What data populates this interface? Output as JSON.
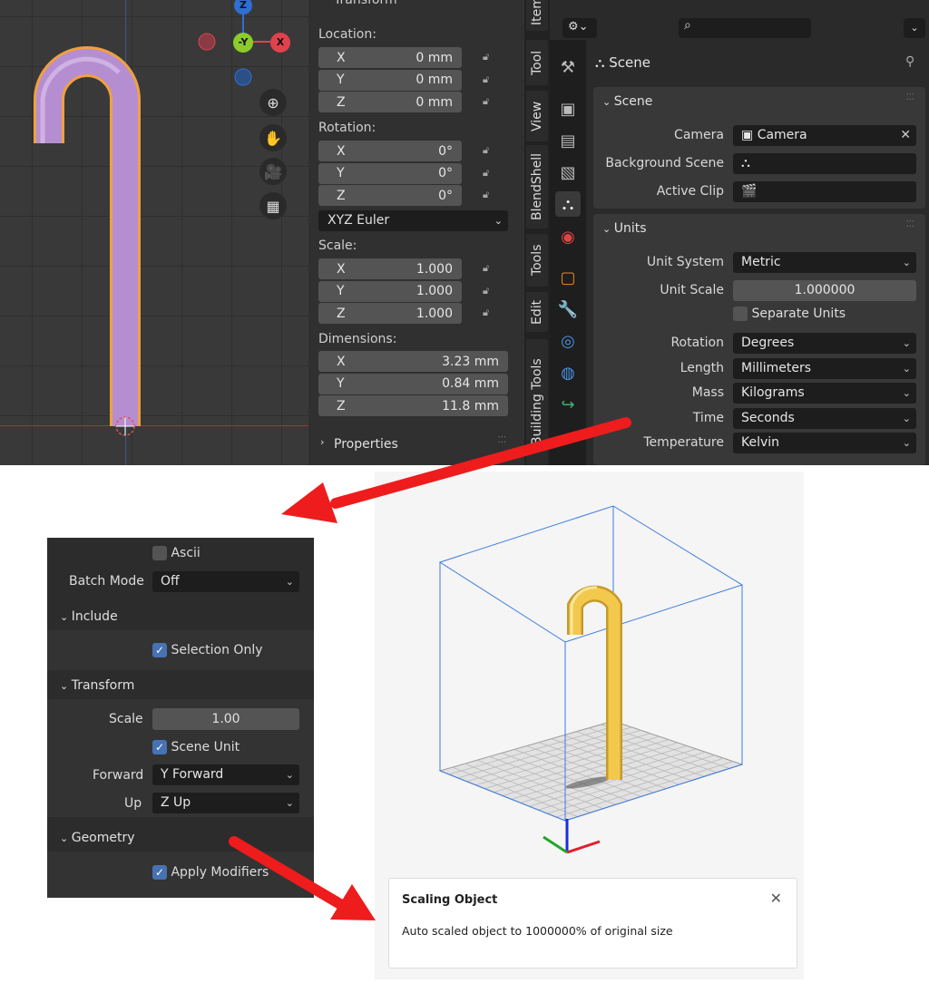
{
  "viewport": {
    "gizmo": {
      "z": "Z",
      "neg_y": "-Y",
      "x": "X"
    },
    "colors": {
      "object": "#b58ed1",
      "outline": "#f0a040",
      "z": "#2f6fd1",
      "y": "#8bcb2a",
      "x": "#e0424d"
    }
  },
  "npanel": {
    "top_header": "Transform",
    "location_label": "Location:",
    "location": [
      {
        "axis": "X",
        "value": "0 mm"
      },
      {
        "axis": "Y",
        "value": "0 mm"
      },
      {
        "axis": "Z",
        "value": "0 mm"
      }
    ],
    "rotation_label": "Rotation:",
    "rotation": [
      {
        "axis": "X",
        "value": "0°"
      },
      {
        "axis": "Y",
        "value": "0°"
      },
      {
        "axis": "Z",
        "value": "0°"
      }
    ],
    "rotation_mode": "XYZ Euler",
    "scale_label": "Scale:",
    "scale": [
      {
        "axis": "X",
        "value": "1.000"
      },
      {
        "axis": "Y",
        "value": "1.000"
      },
      {
        "axis": "Z",
        "value": "1.000"
      }
    ],
    "dimensions_label": "Dimensions:",
    "dimensions": [
      {
        "axis": "X",
        "value": "3.23 mm"
      },
      {
        "axis": "Y",
        "value": "0.84 mm"
      },
      {
        "axis": "Z",
        "value": "11.8 mm"
      }
    ],
    "properties_label": "Properties"
  },
  "tabs": [
    "Item",
    "Tool",
    "View",
    "BlendShell",
    "Tools",
    "Edit",
    "Building Tools"
  ],
  "props": {
    "context_title": "Scene",
    "scene_panel": {
      "title": "Scene",
      "camera_label": "Camera",
      "camera_value": "Camera",
      "background_label": "Background Scene",
      "active_clip_label": "Active Clip"
    },
    "units_panel": {
      "title": "Units",
      "unit_system_label": "Unit System",
      "unit_system": "Metric",
      "unit_scale_label": "Unit Scale",
      "unit_scale": "1.000000",
      "separate_units": "Separate Units",
      "rotation_label": "Rotation",
      "rotation": "Degrees",
      "length_label": "Length",
      "length": "Millimeters",
      "mass_label": "Mass",
      "mass": "Kilograms",
      "time_label": "Time",
      "time": "Seconds",
      "temperature_label": "Temperature",
      "temperature": "Kelvin"
    }
  },
  "export": {
    "ascii": "Ascii",
    "batch_mode_label": "Batch Mode",
    "batch_mode": "Off",
    "include_header": "Include",
    "selection_only": "Selection Only",
    "transform_header": "Transform",
    "scale_label": "Scale",
    "scale_value": "1.00",
    "scene_unit": "Scene Unit",
    "forward_label": "Forward",
    "forward": "Y Forward",
    "up_label": "Up",
    "up": "Z Up",
    "geometry_header": "Geometry",
    "apply_modifiers": "Apply Modifiers"
  },
  "toast": {
    "title": "Scaling Object",
    "message": "Auto scaled object to 1000000% of original size"
  },
  "colors": {
    "arrow": "#ee1c1c",
    "blender_blue": "#4772b3",
    "model_yellow": "#f2c94c",
    "bbox": "#3d7be0"
  }
}
